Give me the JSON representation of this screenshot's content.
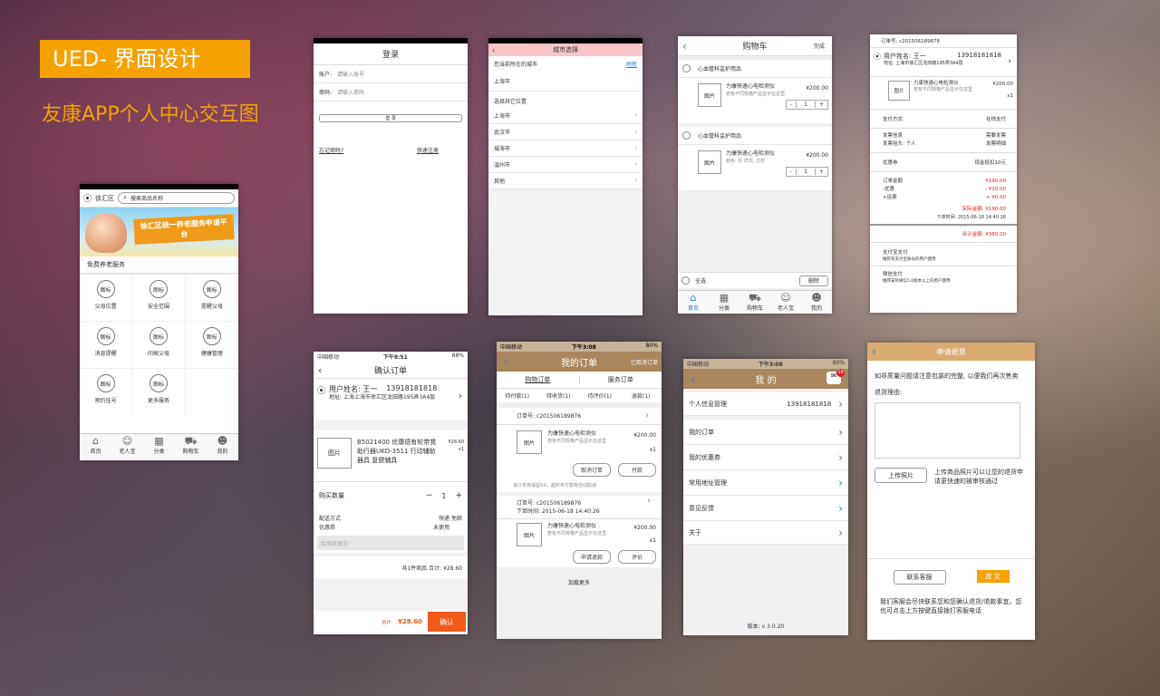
{
  "header": {
    "title": "UED- 界面设计",
    "subtitle": "友康APP个人中心交互图"
  },
  "home": {
    "location": "徐汇区",
    "search_placeholder": "搜索商品名称",
    "banner_text": "徐汇区统一养老服务申请平台",
    "section": "免费养老服务",
    "grid": [
      {
        "icon": "图标",
        "label": "父母位置"
      },
      {
        "icon": "图标",
        "label": "安全范围"
      },
      {
        "icon": "图标",
        "label": "提醒父母"
      },
      {
        "icon": "图标",
        "label": "消息提醒"
      },
      {
        "icon": "图标",
        "label": "问候父母"
      },
      {
        "icon": "图标",
        "label": "健康管理"
      },
      {
        "icon": "图标",
        "label": "预约挂号"
      },
      {
        "icon": "图标",
        "label": "更多服务"
      }
    ],
    "tabs": [
      "首页",
      "老人宝",
      "分类",
      "购物车",
      "我的"
    ]
  },
  "login": {
    "title": "登录",
    "account_label": "账户:",
    "account_placeholder": "请输入账号",
    "password_label": "密码:",
    "password_placeholder": "请输入密码",
    "login_button": "登 录",
    "forgot": "忘记密码?",
    "register": "快速注册"
  },
  "city": {
    "title": "城市选择",
    "current_label": "您当前所在的城市",
    "refresh": "刷新",
    "current_city": "上海市",
    "other_label": "选择其它位置",
    "cities": [
      "上海市",
      "武汉市",
      "城海市",
      "温州市",
      "其他"
    ]
  },
  "cart": {
    "title": "购物车",
    "done": "完成",
    "groups": [
      {
        "group": "心血管科监护用品",
        "name": "力康快速心电检测仪",
        "desc": "若有不同规格产品显示在这里",
        "price": "¥200.00",
        "qty": "1",
        "img": "图片"
      },
      {
        "group": "心血管科监护用品",
        "name": "力康快速心电检测仪",
        "desc": "颜色: 红  样式: 方形",
        "price": "¥200.00",
        "qty": "1",
        "img": "图片"
      }
    ],
    "select_all": "全选",
    "delete": "删除",
    "tabs": [
      "首页",
      "分类",
      "购物车",
      "老人宝",
      "我的"
    ]
  },
  "orderdetail": {
    "order_no": "订单号: c201506189876",
    "user": "用户姓名: 王一",
    "phone": "13918181818",
    "address": "地址: 上海市徐汇区龙田路195弄3A4层",
    "product": "力康快速心电检测仪",
    "product_desc": "若有不同规格产品显示在这里",
    "price": "¥200.00",
    "qty": "x1",
    "img": "图片",
    "pay_label": "支付方式",
    "pay_value": "在线支付",
    "invoice_label": "发票信息",
    "invoice_value": "需要发票",
    "invoice_title_label": "发票抬头: 个人",
    "invoice_detail": "发票明细",
    "coupon_label": "优惠券",
    "coupon_value": "现金抵扣10元",
    "amount_label": "订单金额",
    "amount_value": "¥190.00",
    "discount_label": "-优惠",
    "discount_value": "- ¥10.00",
    "shipping_label": "+运费",
    "shipping_value": "+ ¥0.00",
    "actual_label": "实际金额:",
    "actual_value": "¥190.00",
    "order_time": "下单时间: 2015-06-18 14:40:18",
    "total_label": "合计金额:",
    "total_value": "¥380.00",
    "alipay": "支付宝支付",
    "alipay_desc": "推荐有支付宝账号的用户使用",
    "wechat": "微信支付",
    "wechat_desc": "推荐安装微信5.0版本以上的用户使用"
  },
  "confirm": {
    "status_left": "中国移动",
    "status_time": "下午8:51",
    "status_right": "88%",
    "title": "确认订单",
    "user": "用户姓名: 王一",
    "phone": "13918181818",
    "address": "地址: 上海上海市徐汇区龙田路195弄3A4层",
    "img": "图片",
    "product": "B5021400 优康德有轮带凳助行器UKD-3511 行动辅助器具 复健辅具",
    "price": "¥28.60",
    "qty": "x1",
    "buy_qty_label": "购买数量",
    "qty_value": "1",
    "delivery_label": "配送方式",
    "delivery_value": "快递 免邮",
    "coupon_label": "优惠券",
    "coupon_value": "未使用",
    "note_placeholder": "给卖家留言:",
    "summary": "共1件商品  合计: ¥28.60",
    "total_label": "合计:",
    "total_value": "¥28.60",
    "confirm_button": "确认"
  },
  "myorders": {
    "status_left": "中国移动",
    "status_time": "下午3:08",
    "status_right": "80%",
    "title": "我的订单",
    "cancelled": "已取消订单",
    "tab_buy": "购物订单",
    "tab_service": "服务订单",
    "subtabs": [
      "待付款(1)",
      "待收货(1)",
      "待评价(1)",
      "退款(1)"
    ],
    "order1_no": "订单号: c201506189876",
    "order1_product": "力康快速心电检测仪",
    "order1_desc": "若有不同规格产品显示在这里",
    "order1_price": "¥200.00",
    "order1_qty": "x1",
    "img": "图片",
    "cancel_btn": "取消订单",
    "pay_btn": "付款",
    "note": "该订单将保留XX。超时未付款将自动取消",
    "order2_no": "订单号: c201506189876",
    "order2_time": "下单时间: 2015-06-18  14:40:26",
    "order2_product": "力康快速心电检测仪",
    "order2_desc": "若有不同规格产品显示在这里",
    "order2_price": "¥200.00",
    "order2_qty": "x1",
    "refund_btn": "申请退款",
    "review_btn": "评价",
    "more": "加载更多"
  },
  "mine": {
    "status_left": "中国移动",
    "status_time": "下午3:08",
    "status_right": "80%",
    "title": "我 的",
    "badge": "10",
    "profile": "个人信息管理",
    "phone": "13918181818",
    "items": [
      "我的订单",
      "我的优惠券",
      "常用地址管理",
      "意见反馈",
      "关于"
    ],
    "version": "版本: v 3.0.20"
  },
  "refund": {
    "title": "申请退货",
    "intro": "如非质量问题请注意包装的完整, 以便我们再次售卖",
    "reason_label": "退货理由:",
    "upload_btn": "上传照片",
    "upload_desc": "上传商品照片可以让您的退货申请更快速的被审核通过",
    "contact_btn": "联系客服",
    "submit_btn": "提 交",
    "footer": "我们客服会尽快联系您和您确认退货/退款事宜。您也可点击上方按键直接拨打客服电话"
  }
}
